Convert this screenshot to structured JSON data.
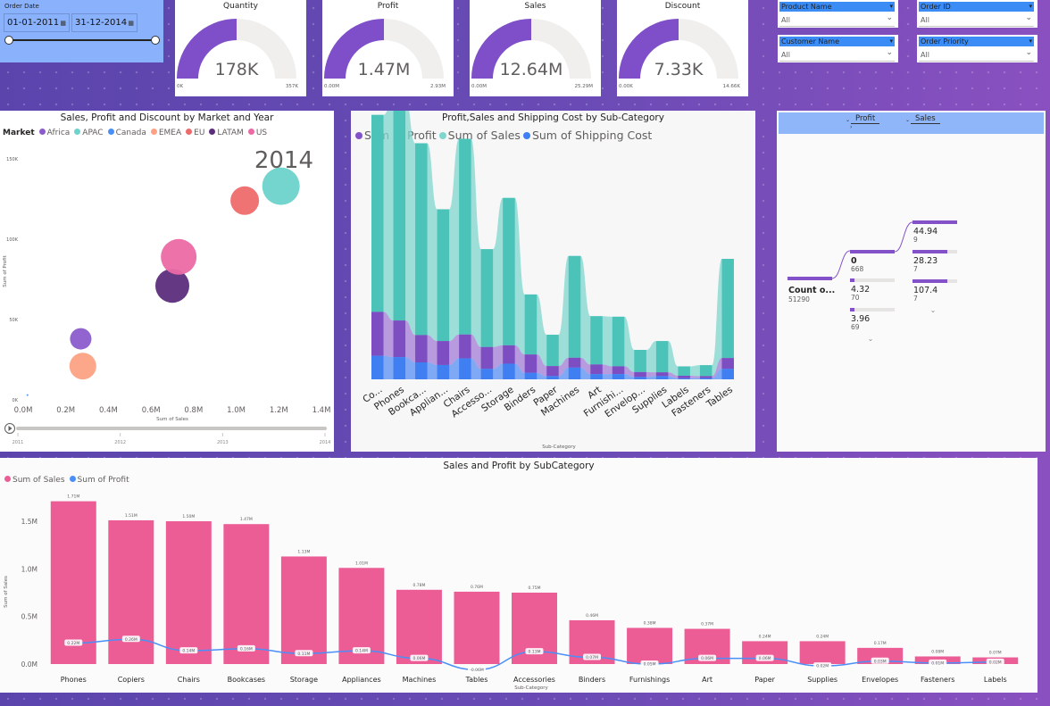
{
  "date_slicer": {
    "title": "Order Date",
    "start": "01-01-2011",
    "end": "31-12-2014"
  },
  "kpis": [
    {
      "title": "Quantity",
      "value": "178K",
      "min": "0K",
      "max": "357K",
      "fill": 0.5,
      "color": "#7f4fc9"
    },
    {
      "title": "Profit",
      "value": "1.47M",
      "min": "0.00M",
      "max": "2.93M",
      "fill": 0.5,
      "color": "#7f4fc9"
    },
    {
      "title": "Sales",
      "value": "12.64M",
      "min": "0.00M",
      "max": "25.29M",
      "fill": 0.5,
      "color": "#7f4fc9"
    },
    {
      "title": "Discount",
      "value": "7.33K",
      "min": "0.00K",
      "max": "14.66K",
      "fill": 0.5,
      "color": "#7f4fc9"
    }
  ],
  "slicers": [
    {
      "title": "Product Name",
      "value": "All"
    },
    {
      "title": "Order ID",
      "value": "All"
    },
    {
      "title": "Customer Name",
      "value": "All"
    },
    {
      "title": "Order Priority",
      "value": "All"
    }
  ],
  "scatter": {
    "title": "Sales, Profit and Discount by Market and Year",
    "legend_title": "Market",
    "year": "2014",
    "xlabel": "Sum of Sales",
    "ylabel": "Sum of Profit",
    "play_ticks": [
      "2011",
      "2012",
      "2013",
      "2014"
    ],
    "chart_data": {
      "type": "scatter",
      "title": "Sales, Profit and Discount by Market and Year",
      "xlabel": "Sum of Sales",
      "ylabel": "Sum of Profit",
      "xlim": [
        0,
        1.4
      ],
      "ylim": [
        0,
        150
      ],
      "x_ticks": [
        "0.0M",
        "0.2M",
        "0.4M",
        "0.6M",
        "0.8M",
        "1.0M",
        "1.2M",
        "1.4M"
      ],
      "y_ticks": [
        "0K",
        "50K",
        "100K",
        "150K"
      ],
      "series": [
        {
          "name": "Africa",
          "color": "#8c5ccc",
          "x": 0.27,
          "y": 38,
          "size": 12
        },
        {
          "name": "APAC",
          "color": "#6dd3cc",
          "x": 1.21,
          "y": 133,
          "size": 21
        },
        {
          "name": "Canada",
          "color": "#4a8ff7",
          "x": 0.02,
          "y": 3,
          "size": 1
        },
        {
          "name": "EMEA",
          "color": "#fca184",
          "x": 0.28,
          "y": 21,
          "size": 15
        },
        {
          "name": "EU",
          "color": "#ef6b6b",
          "x": 1.04,
          "y": 124,
          "size": 16
        },
        {
          "name": "LATAM",
          "color": "#5d2d7c",
          "x": 0.7,
          "y": 71,
          "size": 19
        },
        {
          "name": "US",
          "color": "#ec6aa5",
          "x": 0.73,
          "y": 89,
          "size": 20
        }
      ]
    }
  },
  "ribbon": {
    "title": "Profit,Sales and Shipping Cost by Sub-Category",
    "xlabel": "Sub-Category",
    "chart_data": {
      "type": "bar",
      "title": "Profit,Sales and Shipping Cost by Sub-Category",
      "xlabel": "Sub-Category",
      "categories": [
        "Copiers",
        "Phones",
        "Bookcases",
        "Appliances",
        "Chairs",
        "Accessories",
        "Storage",
        "Binders",
        "Paper",
        "Machines",
        "Art",
        "Furnishings",
        "Envelopes",
        "Supplies",
        "Labels",
        "Fasteners",
        "Tables"
      ],
      "display_categories": [
        "Co...",
        "Phones",
        "Bookca...",
        "Applian...",
        "Chairs",
        "Accesso...",
        "Storage",
        "Binders",
        "Paper",
        "Machines",
        "Art",
        "Furnishi...",
        "Envelop...",
        "Supplies",
        "Labels",
        "Fasteners",
        "Tables"
      ],
      "series": [
        {
          "name": "Sum of Profit",
          "color": "#8351c8",
          "values": [
            259,
            216,
            161,
            141,
            141,
            129,
            108,
            108,
            59,
            58,
            57,
            46,
            29,
            22,
            15,
            12,
            -64
          ]
        },
        {
          "name": "Sum of Sales",
          "color": "#7fd6cf",
          "values": [
            1510,
            1710,
            1470,
            1010,
            1500,
            750,
            1130,
            460,
            240,
            780,
            370,
            380,
            170,
            240,
            72,
            84,
            760
          ]
        },
        {
          "name": "Sum of Shipping Cost",
          "color": "#3f7ff2",
          "values": [
            180,
            170,
            130,
            110,
            160,
            80,
            120,
            50,
            25,
            90,
            40,
            40,
            18,
            25,
            8,
            9,
            80
          ]
        }
      ]
    }
  },
  "decomp": {
    "header": [
      "Profit",
      "Sales"
    ],
    "root": {
      "label": "Count o...",
      "value": "51290"
    },
    "level1": [
      {
        "label": "0",
        "value": "668",
        "fill": 1.0
      },
      {
        "label": "4.32",
        "value": "70",
        "fill": 0.1
      },
      {
        "label": "3.96",
        "value": "69",
        "fill": 0.1
      }
    ],
    "level2": [
      {
        "label": "44.94",
        "value": "9",
        "fill": 1.0
      },
      {
        "label": "28.23",
        "value": "7",
        "fill": 0.78
      },
      {
        "label": "107.4",
        "value": "7",
        "fill": 0.78
      }
    ]
  },
  "combo": {
    "title": "Sales and Profit by SubCategory",
    "xlabel": "Sub-Category",
    "ylabel": "Sum of Sales",
    "chart_data": {
      "type": "bar",
      "title": "Sales and Profit by SubCategory",
      "xlabel": "Sub-Category",
      "ylabel": "Sum of Sales",
      "ylim": [
        0,
        1.8
      ],
      "y_ticks": [
        "0.0M",
        "0.5M",
        "1.0M",
        "1.5M"
      ],
      "categories": [
        "Phones",
        "Copiers",
        "Chairs",
        "Bookcases",
        "Storage",
        "Appliances",
        "Machines",
        "Tables",
        "Accessories",
        "Binders",
        "Furnishings",
        "Art",
        "Paper",
        "Supplies",
        "Envelopes",
        "Fasteners",
        "Labels"
      ],
      "series": [
        {
          "name": "Sum of Sales",
          "color": "#ec5d96",
          "values": [
            1.71,
            1.51,
            1.5,
            1.47,
            1.13,
            1.01,
            0.78,
            0.76,
            0.75,
            0.46,
            0.38,
            0.37,
            0.24,
            0.24,
            0.17,
            0.08,
            0.07
          ],
          "labels": [
            "1.71M",
            "1.51M",
            "1.50M",
            "1.47M",
            "1.13M",
            "1.01M",
            "0.78M",
            "0.76M",
            "0.75M",
            "0.46M",
            "0.38M",
            "0.37M",
            "0.24M",
            "0.24M",
            "0.17M",
            "0.08M",
            "0.07M"
          ]
        },
        {
          "name": "Sum of Profit",
          "color": "#4a8ff7",
          "values": [
            0.22,
            0.26,
            0.14,
            0.16,
            0.11,
            0.14,
            0.06,
            -0.06,
            0.13,
            0.07,
            0.0,
            0.06,
            0.06,
            -0.02,
            0.03,
            0.01,
            0.02
          ],
          "labels": [
            "0.22M",
            "0.26M",
            "0.14M",
            "0.16M",
            "0.11M",
            "0.14M",
            "0.06M",
            "-0.06M",
            "0.13M",
            "0.07M",
            "0.05M",
            "0.06M",
            "0.06M",
            "0.02M",
            "0.03M",
            "0.01M",
            "0.02M"
          ]
        }
      ]
    }
  }
}
